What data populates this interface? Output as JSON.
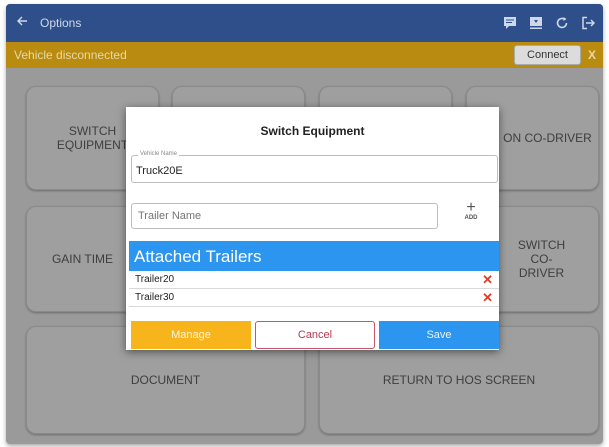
{
  "appbar": {
    "title": "Options"
  },
  "status": {
    "message": "Vehicle disconnected",
    "connect_label": "Connect",
    "close_label": "X"
  },
  "tiles": {
    "switch_equipment": "SWITCH EQUIPMENT",
    "on_codriver": "ON CO-DRIVER",
    "gain_time": "GAIN TIME",
    "switch_codriver": "SWITCH CO-DRIVER",
    "document": "DOCUMENT",
    "return_hos": "RETURN TO HOS SCREEN"
  },
  "dialog": {
    "title": "Switch Equipment",
    "vehicle_legend": "Vehicle Name",
    "vehicle_value": "Truck20E",
    "trailer_placeholder": "Trailer Name",
    "add_label": "ADD",
    "attached_header": "Attached Trailers",
    "trailers": [
      "Trailer20",
      "Trailer30"
    ],
    "manage_label": "Manage",
    "cancel_label": "Cancel",
    "save_label": "Save"
  },
  "colors": {
    "appbar": "#2f4f8a",
    "status": "#b98b10",
    "accent_blue": "#2b95f0",
    "accent_yellow": "#f8b41b",
    "delete_red": "#e23b2a"
  },
  "icons": {
    "back": "arrow-left-icon",
    "message": "message-icon",
    "download": "download-icon",
    "refresh": "refresh-icon",
    "logout": "logout-icon",
    "delete": "close-icon"
  }
}
